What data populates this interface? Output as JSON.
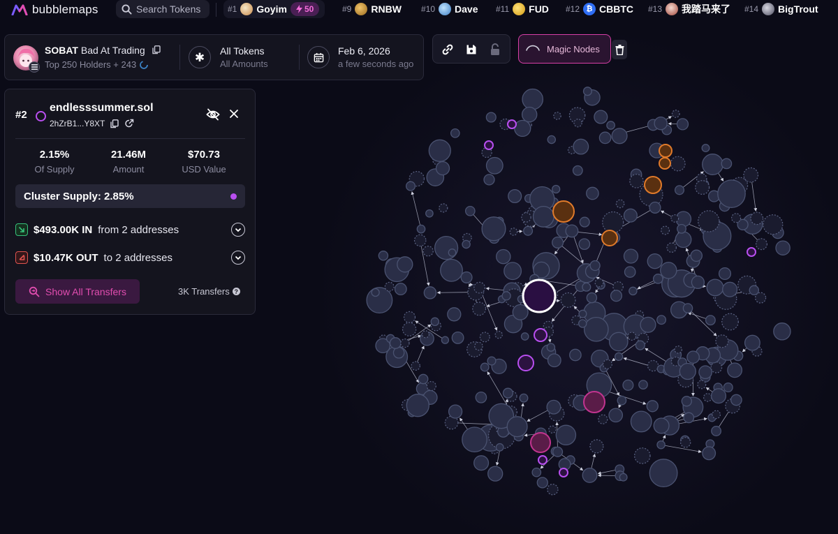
{
  "app": {
    "logo_text": "bubblemaps"
  },
  "search": {
    "placeholder": "Search Tokens"
  },
  "tickers": [
    {
      "rank": "#1",
      "name": "Goyim",
      "badge": "50",
      "active": true
    },
    {
      "rank": "#9",
      "name": "RNBW"
    },
    {
      "rank": "#10",
      "name": "Dave"
    },
    {
      "rank": "#11",
      "name": "FUD"
    },
    {
      "rank": "#12",
      "name": "CBBTC"
    },
    {
      "rank": "#13",
      "name": "我踏马来了"
    },
    {
      "rank": "#14",
      "name": "BigTrout"
    }
  ],
  "header": {
    "token_symbol": "SOBAT",
    "token_name": "Bad At Trading",
    "holders_label": "Top 250 Holders + 243",
    "filter_title": "All Tokens",
    "filter_sub": "All Amounts",
    "date": "Feb 6, 2026",
    "date_sub": "a few seconds ago"
  },
  "toolbar": {
    "magic_label": "Magic Nodes"
  },
  "wallet": {
    "rank": "#2",
    "name": "endlesssummer.sol",
    "address": "2hZrB1...Y8XT",
    "stats": [
      {
        "value": "2.15%",
        "label": "Of Supply"
      },
      {
        "value": "21.46M",
        "label": "Amount"
      },
      {
        "value": "$70.73",
        "label": "USD Value"
      }
    ],
    "cluster_supply": "Cluster Supply: 2.85%",
    "in_amount": "$493.00K IN",
    "in_text": "from 2 addresses",
    "out_amount": "$10.47K OUT",
    "out_text": "to 2 addresses",
    "show_all_label": "Show All Transfers",
    "transfers_count": "3K Transfers"
  },
  "colors": {
    "background": "#0b0b17",
    "bubble_default": "#4a5270",
    "bubble_highlight": "#b94ff0",
    "bubble_cluster_pink": "#c2348f",
    "bubble_cluster_orange": "#e07a2a",
    "accent": "#e24db0"
  }
}
